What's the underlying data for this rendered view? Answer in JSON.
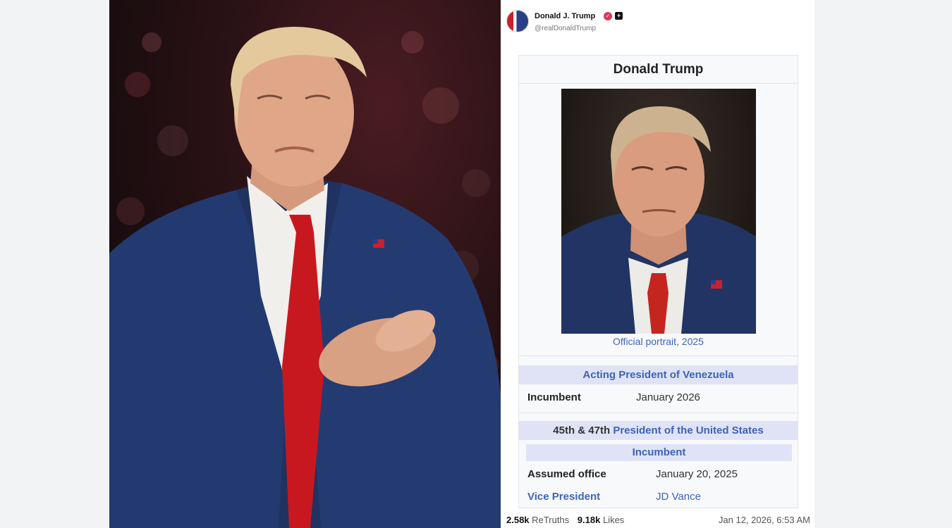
{
  "post": {
    "author": {
      "display_name": "Donald J. Trump",
      "handle": "@realDonaldTrump",
      "verified_icon": "verified-badge-icon",
      "plus_icon": "plus-badge-icon"
    },
    "infobox": {
      "title": "Donald Trump",
      "caption": "Official portrait, 2025",
      "venezuela": {
        "header": "Acting President of Venezuela",
        "incumbent_label": "Incumbent",
        "incumbent_value": "January 2026"
      },
      "us": {
        "header_prefix": "45th & 47th",
        "header_link": "President of the United States",
        "incumbent_header": "Incumbent",
        "assumed_label": "Assumed office",
        "assumed_value": "January 20, 2025",
        "vp_label": "Vice President",
        "vp_value": "JD Vance"
      }
    },
    "footer": {
      "retruths_count": "2.58k",
      "retruths_label": "ReTruths",
      "likes_count": "9.18k",
      "likes_label": "Likes",
      "timestamp": "Jan 12, 2026, 6:53 AM"
    }
  },
  "colors": {
    "link": "#3e64b6",
    "section_header_bg": "#dfe3f5",
    "verified": "#e0375a"
  }
}
